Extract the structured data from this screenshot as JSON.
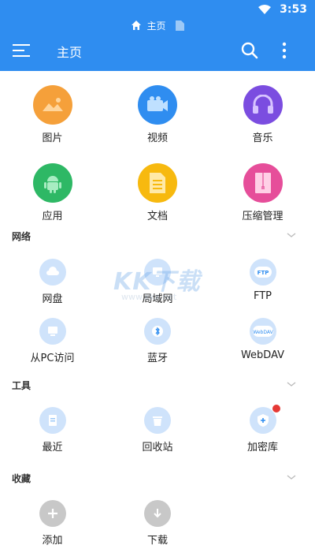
{
  "status": {
    "time": "3:53"
  },
  "breadcrumb": {
    "label": "主页"
  },
  "appbar": {
    "title": "主页"
  },
  "main_tiles": [
    {
      "label": "图片",
      "icon": "image-icon",
      "color": "#f5a03a"
    },
    {
      "label": "视频",
      "icon": "video-icon",
      "color": "#2f8df0"
    },
    {
      "label": "音乐",
      "icon": "music-icon",
      "color": "#7b4de0"
    },
    {
      "label": "应用",
      "icon": "android-icon",
      "color": "#2eb865"
    },
    {
      "label": "文档",
      "icon": "document-icon",
      "color": "#f7b90f"
    },
    {
      "label": "压缩管理",
      "icon": "archive-icon",
      "color": "#e64e9a"
    }
  ],
  "sections": {
    "network": {
      "title": "网络",
      "items": [
        {
          "label": "网盘",
          "icon": "cloud-icon"
        },
        {
          "label": "局域网",
          "icon": "lan-icon"
        },
        {
          "label": "FTP",
          "icon": "ftp-icon"
        },
        {
          "label": "从PC访问",
          "icon": "pc-access-icon"
        },
        {
          "label": "蓝牙",
          "icon": "bluetooth-icon"
        },
        {
          "label": "WebDAV",
          "icon": "webdav-icon"
        }
      ]
    },
    "tools": {
      "title": "工具",
      "items": [
        {
          "label": "最近",
          "icon": "recent-icon"
        },
        {
          "label": "回收站",
          "icon": "recycle-bin-icon"
        },
        {
          "label": "加密库",
          "icon": "vault-icon"
        }
      ]
    },
    "favorites": {
      "title": "收藏",
      "items": [
        {
          "label": "添加",
          "icon": "add-icon"
        },
        {
          "label": "下载",
          "icon": "download-icon"
        }
      ]
    }
  },
  "watermark": {
    "text": "KK下载",
    "url": "www.kkx.net"
  }
}
